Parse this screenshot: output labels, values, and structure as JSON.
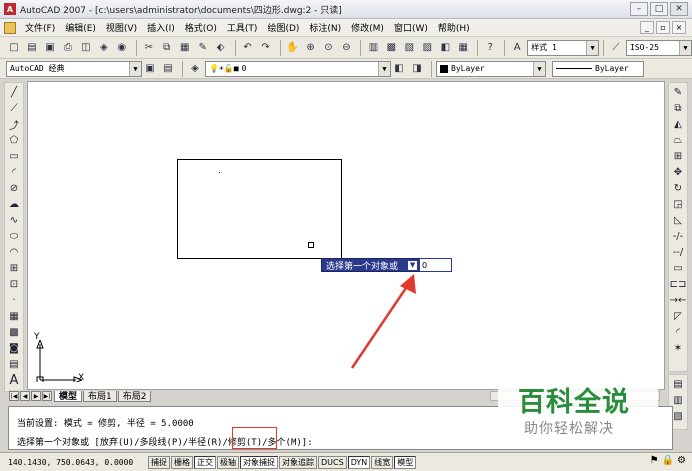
{
  "titlebar": {
    "title": "AutoCAD 2007 - [c:\\users\\administrator\\documents\\四边形.dwg:2 - 只读]"
  },
  "menubar": {
    "items": [
      "文件(F)",
      "编辑(E)",
      "视图(V)",
      "插入(I)",
      "格式(O)",
      "工具(T)",
      "绘图(D)",
      "标注(N)",
      "修改(M)",
      "窗口(W)",
      "帮助(H)"
    ]
  },
  "toolbar1": {
    "text_style": "样式 1",
    "dim_style": "ISO-25"
  },
  "toolbar2": {
    "workspace": "AutoCAD 经典",
    "layer": "0",
    "color": "ByLayer",
    "linetype": "ByLayer"
  },
  "canvas": {
    "tooltip": "选择第一个对象或",
    "dyn_input_value": "0",
    "ucs_x": "X",
    "ucs_y": "Y"
  },
  "layout_tabs": [
    "模型",
    "布局1",
    "布局2"
  ],
  "command": {
    "line1": "当前设置: 模式 = 修剪, 半径 = 5.0000",
    "line2": "选择第一个对象或 [放弃(U)/多段线(P)/半径(R)/修剪(T)/多个(M)]:"
  },
  "statusbar": {
    "coords": "140.1430,  750.0643,  0.0000",
    "toggles": [
      "捕捉",
      "栅格",
      "正交",
      "极轴",
      "对象捕捉",
      "对象追踪",
      "DUCS",
      "DYN",
      "线宽",
      "模型"
    ],
    "on_index": [
      2,
      4,
      7,
      9
    ]
  },
  "watermark": {
    "title": "百科全说",
    "subtitle": "助你轻松解决"
  },
  "colors": {
    "annotation_red": "#e03a2e",
    "tooltip_blue": "#2b3a8c",
    "watermark_green": "#2a8d3c"
  }
}
